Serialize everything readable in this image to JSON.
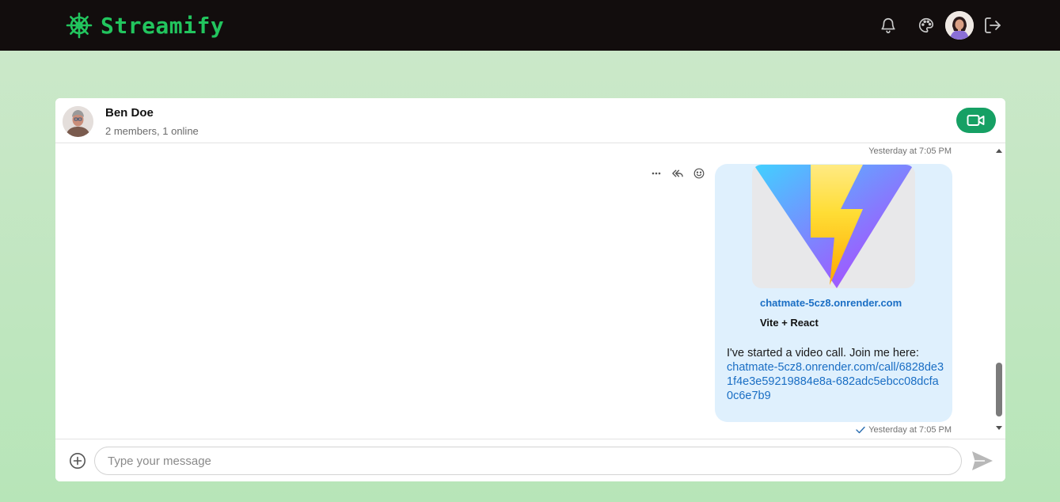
{
  "app": {
    "name": "Streamify",
    "accent": "#22c55e"
  },
  "navbar": {
    "icons": [
      "bell-icon",
      "palette-icon",
      "user-avatar",
      "logout-icon"
    ]
  },
  "channel": {
    "name": "Ben Doe",
    "members": "2 members, 1 online"
  },
  "messages": [
    {
      "timestamp_top": "Yesterday at 7:05 PM",
      "preview": {
        "domain": "chatmate-5cz8.onrender.com",
        "title": "Vite + React"
      },
      "text": "I've started a video call. Join me here:",
      "link": "chatmate-5cz8.onrender.com/call/6828de31f4e3e59219884e8a-682adc5ebcc08dcfa0c6e7b9",
      "timestamp": "Yesterday at 7:05 PM",
      "status": "sent"
    }
  ],
  "composer": {
    "placeholder": "Type your message"
  },
  "colors": {
    "navbar_bg": "#120d0d",
    "page_bg": "#c5e8c3",
    "bubble_bg": "#dff0fd",
    "video_button": "#16a064",
    "link": "#1a6ec4"
  }
}
